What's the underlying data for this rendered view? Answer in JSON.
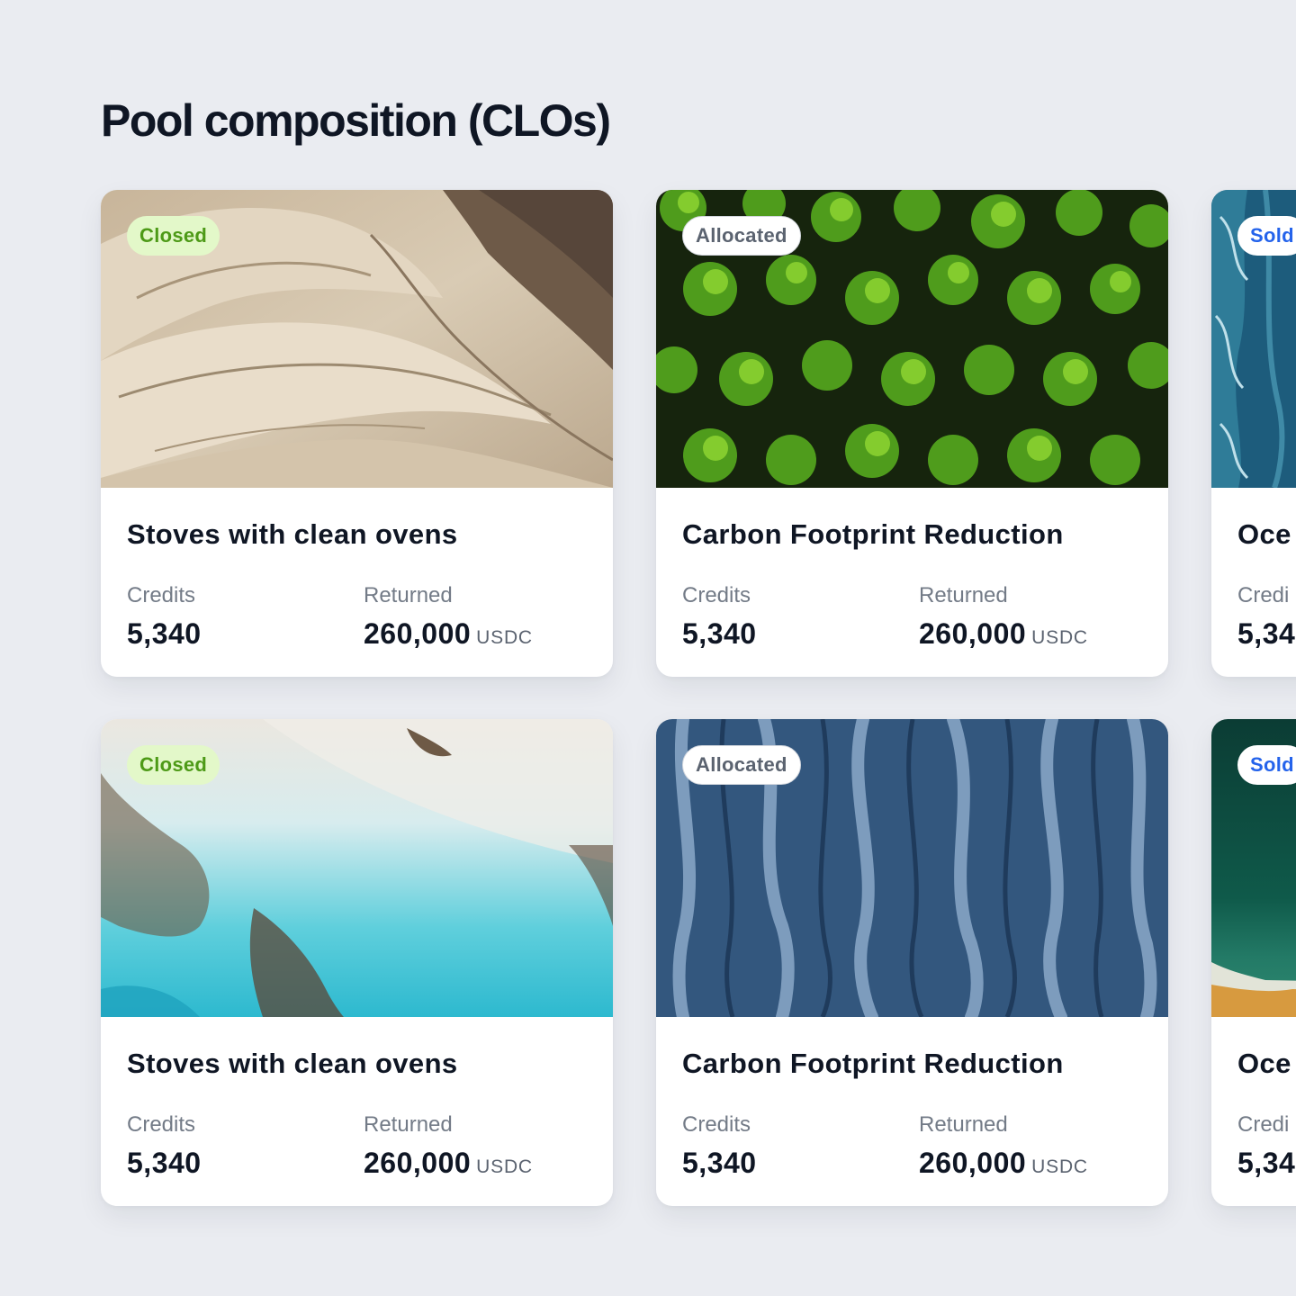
{
  "page": {
    "title": "Pool composition (CLOs)"
  },
  "cards": [
    {
      "status": "Closed",
      "title": "Stoves with clean ovens",
      "credits_label": "Credits",
      "credits_value": "5,340",
      "returned_label": "Returned",
      "returned_value": "260,000",
      "returned_unit": "USDC",
      "image": "desert-mountain-aerial"
    },
    {
      "status": "Allocated",
      "title": "Carbon Footprint Reduction",
      "credits_label": "Credits",
      "credits_value": "5,340",
      "returned_label": "Returned",
      "returned_value": "260,000",
      "returned_unit": "USDC",
      "image": "forest-treetops-aerial"
    },
    {
      "status": "Sold",
      "title": "Oce",
      "credits_label": "Credi",
      "credits_value": "5,34",
      "image": "ocean-waves-aerial"
    },
    {
      "status": "Closed",
      "title": "Stoves with clean ovens",
      "credits_label": "Credits",
      "credits_value": "5,340",
      "returned_label": "Returned",
      "returned_value": "260,000",
      "returned_unit": "USDC",
      "image": "turquoise-shore-aerial"
    },
    {
      "status": "Allocated",
      "title": "Carbon Footprint Reduction",
      "credits_label": "Credits",
      "credits_value": "5,340",
      "returned_label": "Returned",
      "returned_value": "260,000",
      "returned_unit": "USDC",
      "image": "blue-eroded-terrain-aerial"
    },
    {
      "status": "Sold",
      "title": "Oce",
      "credits_label": "Credi",
      "credits_value": "5,34",
      "image": "green-sea-beach-aerial"
    }
  ],
  "colors": {
    "background": "#eaecf1",
    "closed_badge_bg": "#e3f8c9",
    "closed_badge_text": "#4d9a17",
    "sold_badge_text": "#2463eb",
    "allocated_badge_text": "#5b6370"
  }
}
